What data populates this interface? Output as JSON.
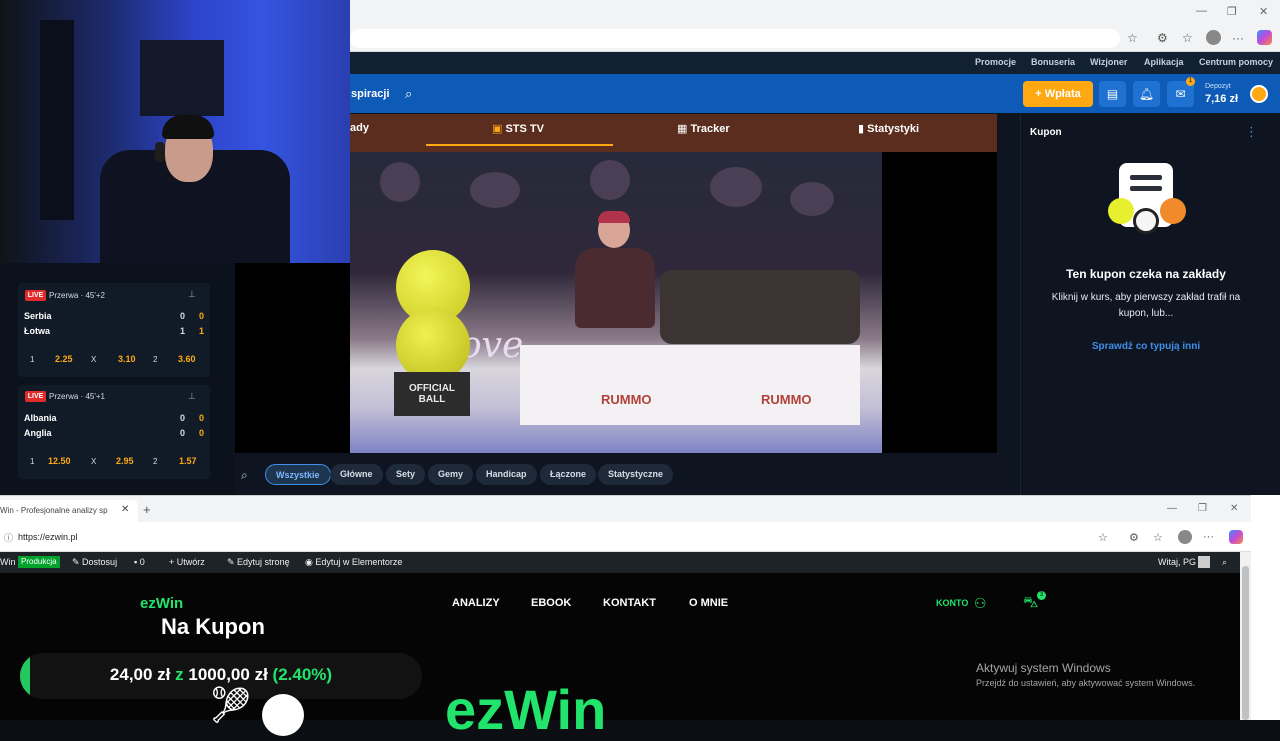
{
  "sts": {
    "top_links": [
      "Promocje",
      "Bonuseria",
      "Wizjoner",
      "Aplikacja",
      "Centrum pomocy"
    ],
    "nav_inspiracji": "spiracji",
    "deposit_button": "Wpłata",
    "notif_count": "1",
    "depozyt_label": "Depozyt",
    "depozyt_value": "7,16 zł",
    "tabs": {
      "left_partial": "ady",
      "sts_tv": "STS TV",
      "tracker": "Tracker",
      "statystyki": "Statystyki"
    },
    "video": {
      "official_ball": "OFFICIAL BALL",
      "brand1": "RUMMO",
      "brand2": "RUMMO",
      "banner": "ove"
    },
    "market_chips": [
      "Wszystkie",
      "Główne",
      "Sety",
      "Gemy",
      "Handicap",
      "Łączone",
      "Statystyczne"
    ],
    "coupon": {
      "title": "Kupon",
      "heading": "Ten kupon czeka na zakłady",
      "text": "Kliknij w kurs, aby pierwszy zakład trafił na kupon, lub...",
      "link": "Sprawdź co typują inni"
    },
    "matches": [
      {
        "live": "LIVE",
        "status": "Przerwa · 45'+2",
        "team1": "Serbia",
        "team2": "Łotwa",
        "score1a": "0",
        "score1b": "0",
        "score2a": "1",
        "score2b": "1",
        "k1": "1",
        "v1": "2.25",
        "kx": "X",
        "vx": "3.10",
        "k2": "2",
        "v2": "3.60"
      },
      {
        "live": "LIVE",
        "status": "Przerwa · 45'+1",
        "team1": "Albania",
        "team2": "Anglia",
        "score1a": "0",
        "score1b": "0",
        "score2a": "0",
        "score2b": "0",
        "k1": "1",
        "v1": "12.50",
        "kx": "X",
        "vx": "2.95",
        "k2": "2",
        "v2": "1.57"
      }
    ]
  },
  "ezwin_browser": {
    "tab_title": "Win - Profesjonalne analizy sp",
    "url": "https://ezwin.pl",
    "admin_bar": {
      "site": "Win",
      "env": "Produkcja",
      "customize": "Dostosuj",
      "comments": "0",
      "create": "Utwórz",
      "edit_page": "Edytuj stronę",
      "elementor": "Edytuj w Elementorze",
      "greeting": "Witaj, PG"
    },
    "logo": "ezWin",
    "nav": [
      "ANALIZY",
      "EBOOK",
      "KONTAKT",
      "O MNIE"
    ],
    "konto": "KONTO",
    "cart_count": "3",
    "hero": "ezWin"
  },
  "overlay": {
    "title": "Na Kupon",
    "amount_current": "24,00 zł",
    "connector": "z",
    "amount_target": "1000,00 zł",
    "percent_text": "(2.40%)",
    "progress_fraction": 0.024
  },
  "windows": {
    "activate_title": "Aktywuj system Windows",
    "activate_sub": "Przejdź do ustawień, aby aktywować system Windows."
  },
  "icons": {
    "search": "search-icon",
    "pin": "pin-icon",
    "bell": "bell-icon",
    "mail": "mail-icon",
    "cart": "cart-icon",
    "user": "user-icon",
    "star": "star-icon",
    "menu": "kebab-menu-icon"
  },
  "colors": {
    "sts_blue": "#0d5bb7",
    "sts_orange": "#ffa812",
    "live_red": "#e02b2b",
    "ezwin_green": "#22e36b",
    "coupon_link": "#3f8ee8"
  }
}
